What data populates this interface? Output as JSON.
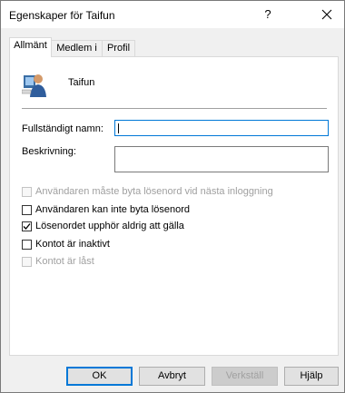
{
  "window": {
    "title": "Egenskaper för Taifun",
    "help_symbol": "?",
    "close_symbol": "✕"
  },
  "tabs": [
    {
      "label": "Allmänt",
      "active": true
    },
    {
      "label": "Medlem i",
      "active": false
    },
    {
      "label": "Profil",
      "active": false
    }
  ],
  "general": {
    "user_icon": "user-icon",
    "username": "Taifun",
    "full_name_label": "Fullständigt namn:",
    "full_name_value": "",
    "description_label": "Beskrivning:",
    "description_value": "",
    "options": [
      {
        "label": "Användaren måste byta lösenord vid nästa inloggning",
        "checked": false,
        "enabled": false
      },
      {
        "label": "Användaren kan inte byta lösenord",
        "checked": false,
        "enabled": true
      },
      {
        "label": "Lösenordet upphör aldrig att gälla",
        "checked": true,
        "enabled": true
      },
      {
        "label": "Kontot är inaktivt",
        "checked": false,
        "enabled": true
      },
      {
        "label": "Kontot är låst",
        "checked": false,
        "enabled": false
      }
    ]
  },
  "buttons": {
    "ok": "OK",
    "cancel": "Avbryt",
    "apply": "Verkställ",
    "help": "Hjälp"
  }
}
